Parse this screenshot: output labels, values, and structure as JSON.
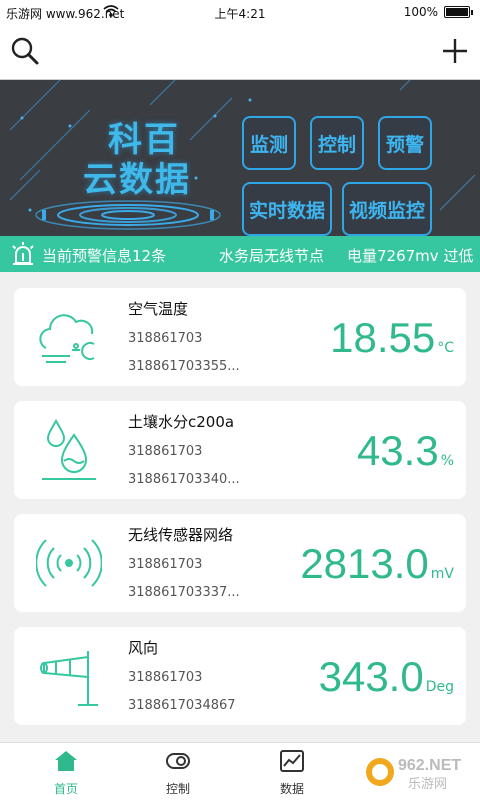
{
  "status": {
    "carrier": "乐游网 www.962.net",
    "time": "上午4:21",
    "battery": "100%"
  },
  "banner": {
    "brand_line1": "科百",
    "brand_line2": "云数据",
    "buttons": [
      "监测",
      "控制",
      "预警",
      "实时数据",
      "视频监控"
    ]
  },
  "alert_strip": {
    "warning_count_text": "当前预警信息12条",
    "node_text": "水务局无线节点",
    "power_text": "电量7267mv 过低"
  },
  "sensors": [
    {
      "name": "空气温度",
      "id": "318861703",
      "serial": "318861703355...",
      "value": "18.55",
      "unit": "°C",
      "icon": "cloud-temperature-icon"
    },
    {
      "name": "土壤水分c200a",
      "id": "318861703",
      "serial": "318861703340...",
      "value": "43.3",
      "unit": "%",
      "icon": "water-drop-icon"
    },
    {
      "name": "无线传感器网络",
      "id": "318861703",
      "serial": "318861703337...",
      "value": "2813.0",
      "unit": "mV",
      "icon": "wireless-signal-icon"
    },
    {
      "name": "风向",
      "id": "318861703",
      "serial": "3188617034867",
      "value": "343.0",
      "unit": "Deg",
      "icon": "windsock-icon"
    }
  ],
  "nav": {
    "home": "首页",
    "control": "控制",
    "data": "数据"
  },
  "watermark": "962.NET 乐游网",
  "colors": {
    "accent": "#37c7a0",
    "value_green": "#30b98c",
    "banner_blue": "#2fa6e6",
    "banner_bg": "#3a3d42"
  }
}
